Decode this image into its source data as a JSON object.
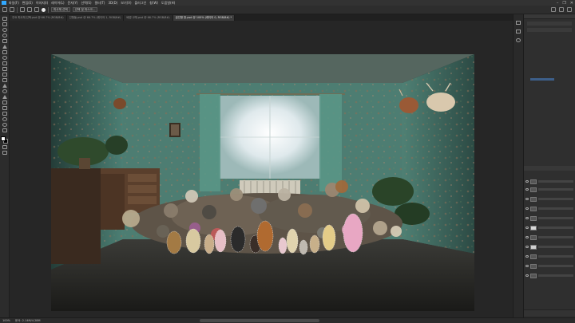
{
  "menu": {
    "items": [
      "파일(F)",
      "편집(E)",
      "이미지(I)",
      "레이어(L)",
      "문자(Y)",
      "선택(S)",
      "필터(T)",
      "3D(D)",
      "보기(V)",
      "플러그인",
      "창(W)",
      "도움말(H)"
    ],
    "window_controls": [
      "–",
      "❐",
      "✕"
    ]
  },
  "options": {
    "selection_btn": "피사체 선택",
    "mask_btn": "선택 및 마스크..."
  },
  "tabs": [
    {
      "label": "주요 피사체 선택.psd @ 66.7% (RGB/8#)",
      "active": false
    },
    {
      "label": "인형들.psd @ 66.7% (레이어 1, RGB/8#)",
      "active": false
    },
    {
      "label": "배경 교체.psd @ 66.7% (RGB/8#)",
      "active": false
    },
    {
      "label": "곰인형 방.psd @ 100% (레이어 0, RGB/8#) *",
      "active": true
    }
  ],
  "status": {
    "zoom": "100%",
    "doc_info": "문서: 2.14M/4.28M"
  },
  "colors": {
    "accent": "#31a8ff",
    "chrome_dark": "#262626",
    "panel": "#2f2f2f"
  },
  "icons": [
    "move-icon",
    "marquee-icon",
    "lasso-icon",
    "quick-select-icon",
    "crop-icon",
    "eyedropper-icon",
    "healing-icon",
    "brush-icon",
    "stamp-icon",
    "history-brush-icon",
    "eraser-icon",
    "gradient-icon",
    "blur-icon",
    "dodge-icon",
    "pen-icon",
    "type-icon",
    "path-select-icon",
    "shape-icon",
    "hand-icon",
    "zoom-icon"
  ]
}
